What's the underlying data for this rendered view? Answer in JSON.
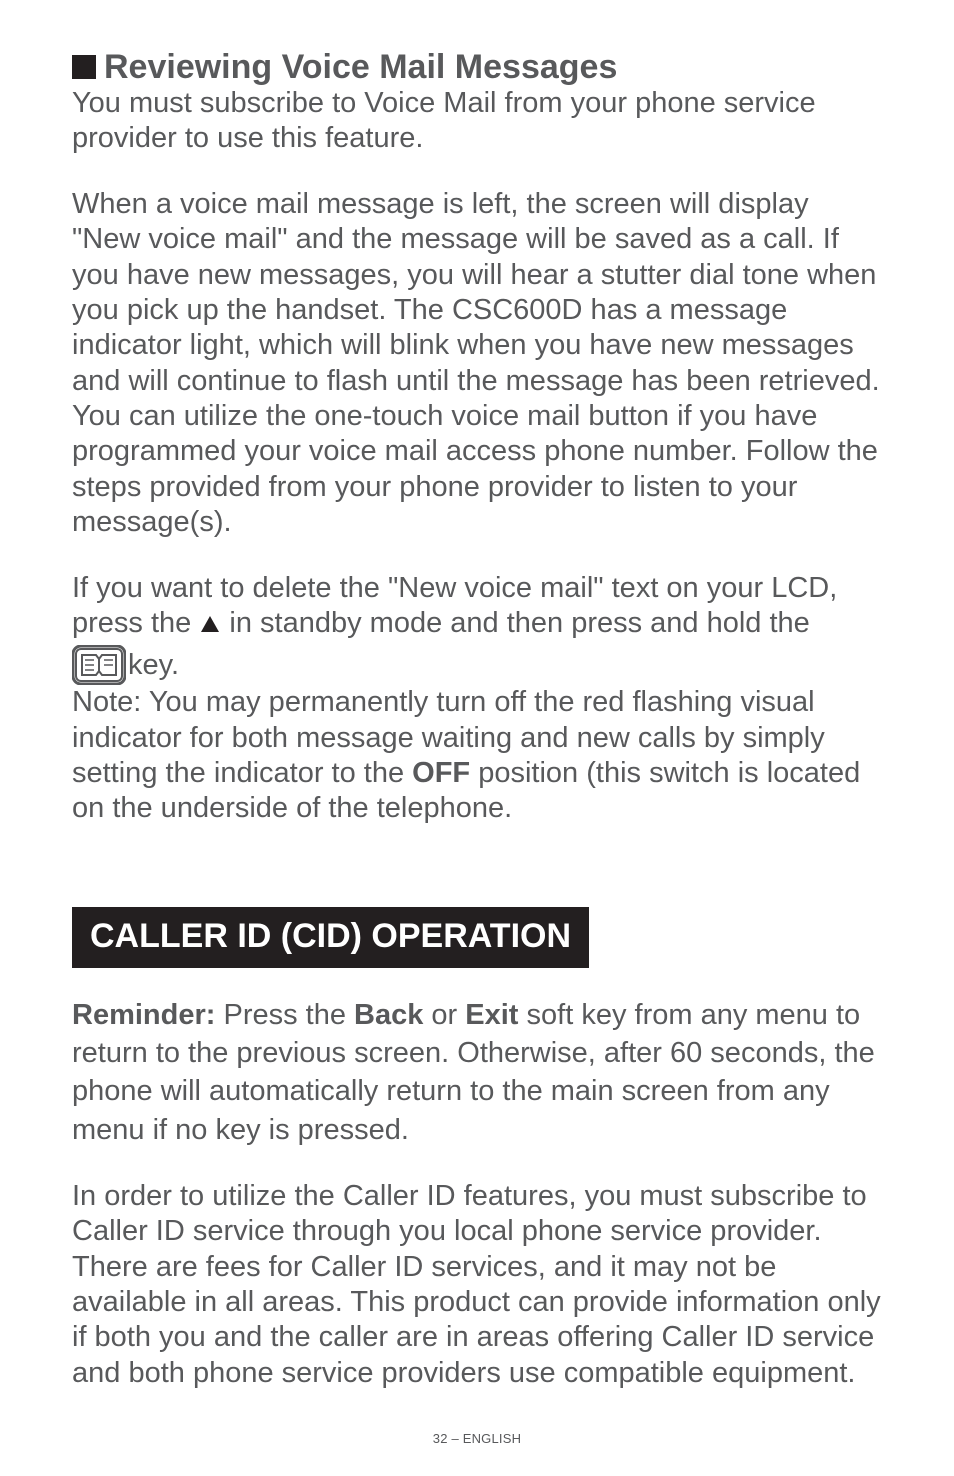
{
  "section1": {
    "heading": "Reviewing Voice Mail Messages",
    "p1": "You must subscribe to Voice Mail from your phone service provider to use this feature.",
    "p2": "When a voice mail message is left, the screen will display \"New voice mail\" and the message will be saved as a call. If you have new messages, you will hear a stutter dial tone when you pick up the handset.  The CSC600D has a message indicator light, which will blink when you have new messages and will continue to flash until the message has been retrieved.  You can utilize the one-touch voice mail button if you have programmed your voice mail access phone number. Follow the steps provided from your phone provider to listen to your message(s).",
    "p3_a": "If you want to delete the \"New voice mail\" text on your LCD, press the ",
    "p3_b": " in standby mode and then press and hold the",
    "key_label": " key.",
    "p4_a": "Note: You may permanently turn off the red flashing visual indicator for both message waiting and new calls by simply setting the indicator to the ",
    "p4_bold": "OFF",
    "p4_b": " position (this switch is located on the underside of the telephone."
  },
  "section2": {
    "heading": "CALLER ID (CID) OPERATION",
    "p1_a": "Reminder:",
    "p1_b": " Press the ",
    "p1_c": "Back",
    "p1_d": " or ",
    "p1_e": "Exit",
    "p1_f": " soft key from any menu to return to the previous screen.  Otherwise, after 60 seconds, the phone will automatically return to the main screen from any menu if no key is pressed.",
    "p2": "In order to utilize the Caller ID features, you must subscribe to Caller ID service through you local phone service provider. There are fees for Caller ID services, and it may not be available in all areas. This product can provide information only if both you and the caller are in areas offering Caller ID service and both phone service providers use compatible equipment."
  },
  "footer": "32 – ENGLISH"
}
